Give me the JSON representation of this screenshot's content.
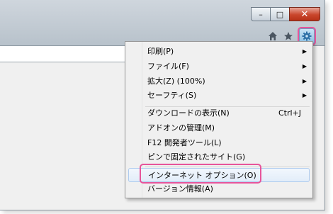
{
  "window": {
    "minimize_label": "–",
    "maximize_label": "□",
    "close_label": "✕"
  },
  "toolbar": {
    "home_icon": "home-icon",
    "favorites_icon": "star-icon",
    "tools_icon": "gear-icon"
  },
  "menu": {
    "items": [
      {
        "label": "印刷(P)",
        "submenu": true
      },
      {
        "label": "ファイル(F)",
        "submenu": true
      },
      {
        "label": "拡大(Z) (100%)",
        "submenu": true
      },
      {
        "label": "セーフティ(S)",
        "submenu": true
      },
      {
        "label": "ダウンロードの表示(N)",
        "shortcut": "Ctrl+J"
      },
      {
        "label": "アドオンの管理(M)"
      },
      {
        "label": "F12 開発者ツール(L)"
      },
      {
        "label": "ピンで固定されたサイト(G)"
      },
      {
        "label": "インターネット オプション(O)"
      },
      {
        "label": "バージョン情報(A)"
      }
    ],
    "arrow_glyph": "▶"
  },
  "colors": {
    "highlight_border": "#e7559b",
    "menu_background": "#f0f0f0",
    "close_button": "#c9462c"
  }
}
